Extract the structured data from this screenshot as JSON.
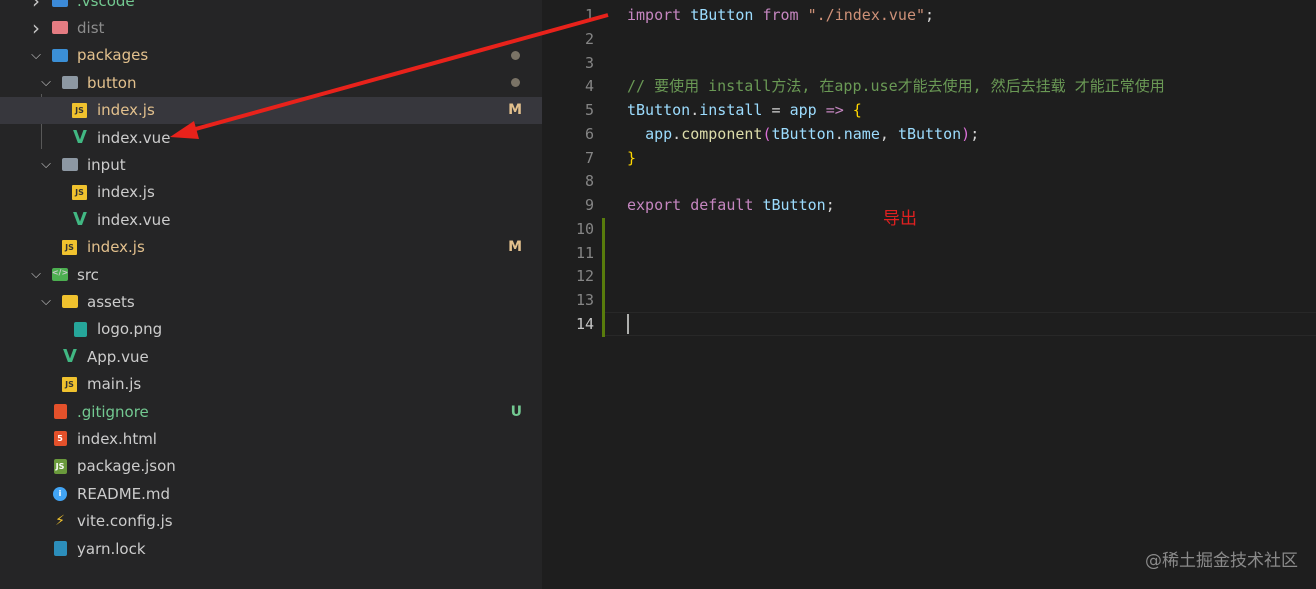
{
  "explorer": {
    "items": [
      {
        "label": ".vscode",
        "level": 0,
        "chev": "right",
        "icon": "vscode-folder-icon",
        "color": "#73c991"
      },
      {
        "label": "dist",
        "level": 0,
        "chev": "right",
        "icon": "dist-folder-icon",
        "color": "#8c8c8c"
      },
      {
        "label": "packages",
        "level": 0,
        "chev": "down",
        "icon": "packages-folder-icon",
        "color": "#e2c08d",
        "dot": true
      },
      {
        "label": "button",
        "level": 1,
        "chev": "down",
        "icon": "folder-open-icon",
        "color": "#e2c08d",
        "dot": true
      },
      {
        "label": "index.js",
        "level": 2,
        "icon": "js-file-icon",
        "color": "#e2c08d",
        "badge": "M",
        "selected": true
      },
      {
        "label": "index.vue",
        "level": 2,
        "icon": "vue-file-icon",
        "color": "#cccccc"
      },
      {
        "label": "input",
        "level": 1,
        "chev": "down",
        "icon": "folder-open-icon",
        "color": "#cccccc"
      },
      {
        "label": "index.js",
        "level": 2,
        "icon": "js-file-icon",
        "color": "#cccccc"
      },
      {
        "label": "index.vue",
        "level": 2,
        "icon": "vue-file-icon",
        "color": "#cccccc"
      },
      {
        "label": "index.js",
        "level": 1,
        "icon": "js-file-icon",
        "color": "#e2c08d",
        "badge": "M"
      },
      {
        "label": "src",
        "level": 0,
        "chev": "down",
        "icon": "src-folder-icon",
        "color": "#cccccc"
      },
      {
        "label": "assets",
        "level": 1,
        "chev": "down",
        "icon": "assets-folder-icon",
        "color": "#cccccc"
      },
      {
        "label": "logo.png",
        "level": 2,
        "icon": "image-file-icon",
        "color": "#cccccc"
      },
      {
        "label": "App.vue",
        "level": 1,
        "icon": "vue-file-icon",
        "color": "#cccccc"
      },
      {
        "label": "main.js",
        "level": 1,
        "icon": "js-file-icon",
        "color": "#cccccc"
      },
      {
        "label": ".gitignore",
        "level": 0,
        "icon": "git-file-icon",
        "color": "#73c991",
        "badge": "U"
      },
      {
        "label": "index.html",
        "level": 0,
        "icon": "html-file-icon",
        "color": "#cccccc"
      },
      {
        "label": "package.json",
        "level": 0,
        "icon": "nodejs-file-icon",
        "color": "#cccccc"
      },
      {
        "label": "README.md",
        "level": 0,
        "icon": "info-file-icon",
        "color": "#cccccc"
      },
      {
        "label": "vite.config.js",
        "level": 0,
        "icon": "vite-file-icon",
        "color": "#cccccc"
      },
      {
        "label": "yarn.lock",
        "level": 0,
        "icon": "yarn-file-icon",
        "color": "#cccccc"
      }
    ]
  },
  "editor": {
    "lines": [
      [
        [
          "kw",
          "import"
        ],
        [
          "",
          ""
        ],
        [
          "var",
          " tButton "
        ],
        [
          "kw",
          "from"
        ],
        [
          "str",
          " \"./index.vue\""
        ],
        [
          "",
          ";"
        ]
      ],
      [],
      [],
      [
        [
          "cm",
          "// 要使用 install方法, 在app.use才能去使用, 然后去挂载 才能正常使用"
        ]
      ],
      [
        [
          "var",
          "tButton"
        ],
        [
          "",
          "."
        ],
        [
          "var",
          "install"
        ],
        [
          "",
          " = "
        ],
        [
          "var",
          "app"
        ],
        [
          "",
          " "
        ],
        [
          "kw",
          "=>"
        ],
        [
          "",
          " "
        ],
        [
          "br",
          "{"
        ]
      ],
      [
        [
          "",
          "  "
        ],
        [
          "var",
          "app"
        ],
        [
          "",
          "."
        ],
        [
          "fn",
          "component"
        ],
        [
          "br2",
          "("
        ],
        [
          "var",
          "tButton"
        ],
        [
          "",
          "."
        ],
        [
          "var",
          "name"
        ],
        [
          "",
          ", "
        ],
        [
          "var",
          "tButton"
        ],
        [
          "br2",
          ")"
        ],
        [
          "",
          ";"
        ]
      ],
      [
        [
          "br",
          "}"
        ]
      ],
      [],
      [
        [
          "kw",
          "export"
        ],
        [
          "",
          " "
        ],
        [
          "kw",
          "default"
        ],
        [
          "",
          " "
        ],
        [
          "var",
          "tButton"
        ],
        [
          "",
          ";"
        ]
      ],
      [],
      [],
      [],
      [],
      []
    ],
    "current_line": 14,
    "annotation": "导出"
  },
  "watermark": "@稀土掘金技术社区"
}
